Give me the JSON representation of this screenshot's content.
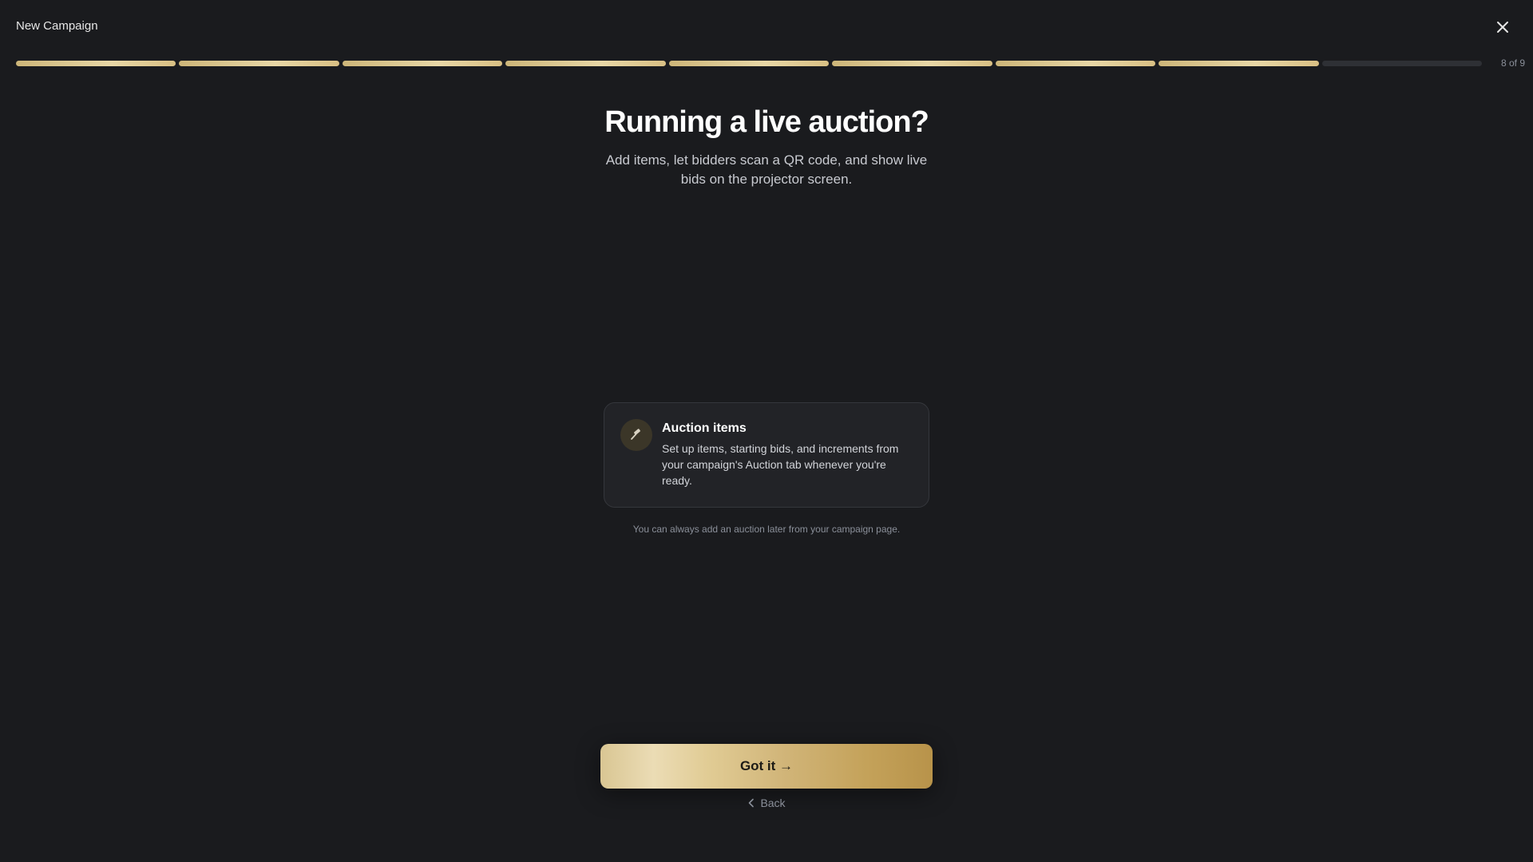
{
  "window": {
    "title": "New Campaign",
    "close_icon": "close-icon"
  },
  "progress": {
    "total_steps": 9,
    "current_step": 8,
    "label": "8 of 9",
    "fill_color": "#d9c084",
    "empty_color": "#2e3035"
  },
  "main": {
    "heading": "Running a live auction?",
    "subheading": "Add items, let bidders scan a QR code, and show live bids on the projector screen."
  },
  "card": {
    "icon": "gavel-icon",
    "title": "Auction items",
    "body": "Set up items, starting bids, and increments from your campaign's Auction tab whenever you're ready."
  },
  "note": "You can always add an auction later from your campaign page.",
  "footer": {
    "primary_label": "Got it →",
    "back_label": "Back",
    "back_icon": "chevron-left-icon"
  }
}
